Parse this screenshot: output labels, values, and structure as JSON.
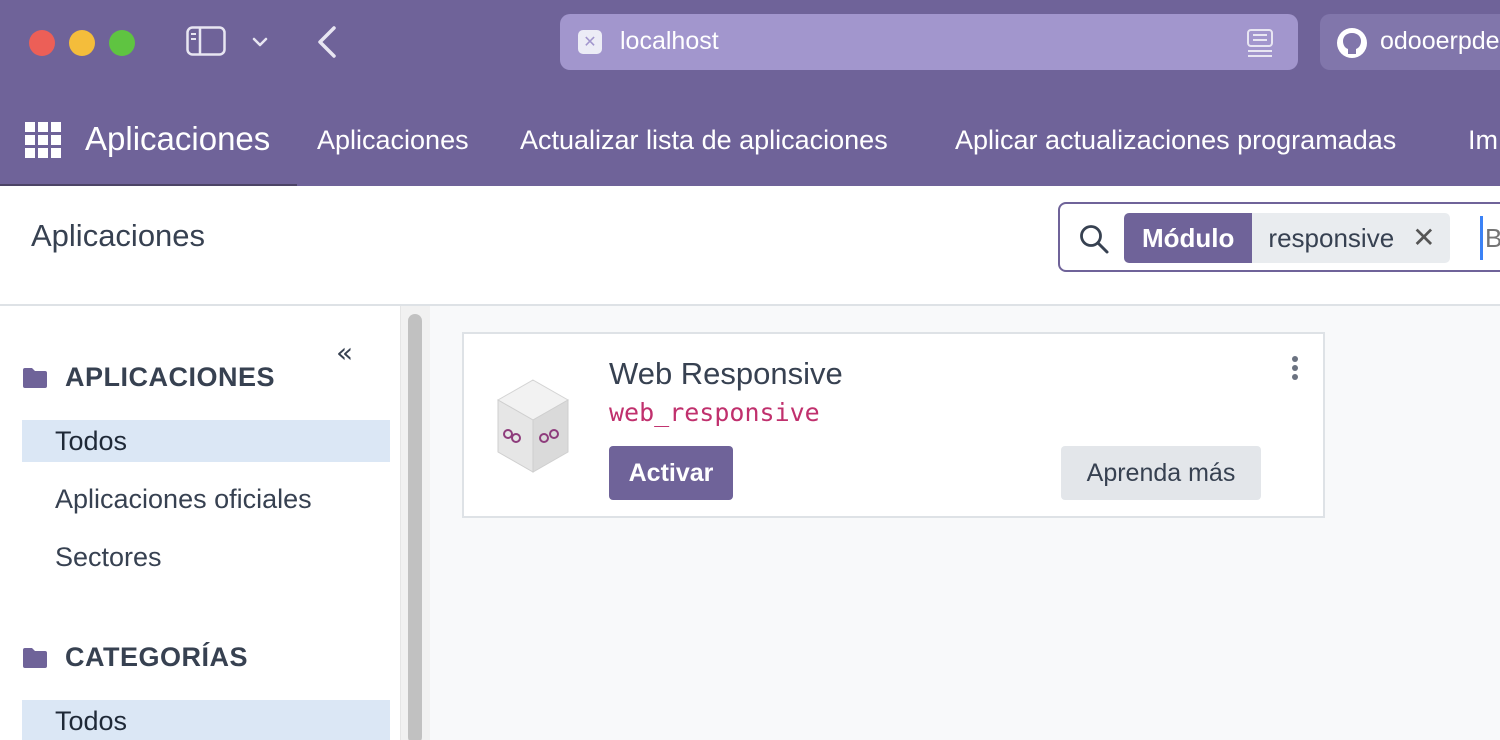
{
  "browser": {
    "url": "localhost",
    "tab2_title": "odooerpde"
  },
  "nav": {
    "brand": "Aplicaciones",
    "items": [
      "Aplicaciones",
      "Actualizar lista de aplicaciones",
      "Aplicar actualizaciones programadas",
      "Im"
    ]
  },
  "control": {
    "breadcrumb": "Aplicaciones",
    "search": {
      "facet_label": "Módulo",
      "facet_value": "responsive",
      "facet_remove": "✕",
      "placeholder": "Buscar..."
    }
  },
  "sidepanel": {
    "collapse": "«",
    "sections": [
      {
        "title": "APLICACIONES",
        "items": [
          "Todos",
          "Aplicaciones oficiales",
          "Sectores"
        ],
        "active": "Todos"
      },
      {
        "title": "CATEGORÍAS",
        "items": [
          "Todos"
        ],
        "active": "Todos"
      }
    ]
  },
  "card": {
    "name": "Web Responsive",
    "technical_name": "web_responsive",
    "activate_label": "Activar",
    "learn_label": "Aprenda más"
  },
  "colors": {
    "primary": "#6f6399",
    "technical_name": "#c0306d",
    "active_item_bg": "#dbe7f5"
  }
}
